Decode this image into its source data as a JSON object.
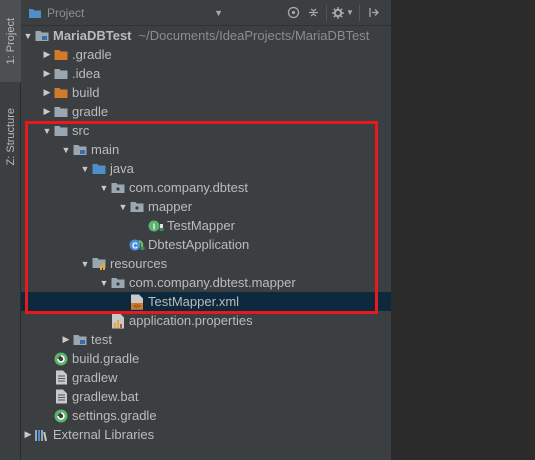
{
  "side_tabs": [
    {
      "label": "1: Project",
      "active": true
    },
    {
      "label": "Z: Structure",
      "active": false
    }
  ],
  "toolbar": {
    "view_label": "Project",
    "buttons": [
      "target-icon",
      "collapse-icon",
      "gear-icon",
      "hide-icon"
    ]
  },
  "tree": [
    {
      "label": "MariaDBTest",
      "path": "~/Documents/IdeaProjects/MariaDBTest",
      "depth": 0,
      "expanded": true,
      "icon": "module-folder-icon",
      "bold": true
    },
    {
      "label": ".gradle",
      "depth": 1,
      "expanded": false,
      "icon": "excluded-folder-icon"
    },
    {
      "label": ".idea",
      "depth": 1,
      "expanded": false,
      "icon": "folder-icon"
    },
    {
      "label": "build",
      "depth": 1,
      "expanded": false,
      "icon": "excluded-folder-icon"
    },
    {
      "label": "gradle",
      "depth": 1,
      "expanded": false,
      "icon": "folder-icon"
    },
    {
      "label": "src",
      "depth": 1,
      "expanded": true,
      "icon": "folder-icon"
    },
    {
      "label": "main",
      "depth": 2,
      "expanded": true,
      "icon": "module-folder-icon"
    },
    {
      "label": "java",
      "depth": 3,
      "expanded": true,
      "icon": "source-root-icon"
    },
    {
      "label": "com.company.dbtest",
      "depth": 4,
      "expanded": true,
      "icon": "package-icon"
    },
    {
      "label": "mapper",
      "depth": 5,
      "expanded": true,
      "icon": "package-icon"
    },
    {
      "label": "TestMapper",
      "depth": 6,
      "expanded": null,
      "icon": "interface-icon"
    },
    {
      "label": "DbtestApplication",
      "depth": 5,
      "expanded": null,
      "icon": "spring-class-icon"
    },
    {
      "label": "resources",
      "depth": 3,
      "expanded": true,
      "icon": "resources-root-icon"
    },
    {
      "label": "com.company.dbtest.mapper",
      "depth": 4,
      "expanded": true,
      "icon": "package-icon"
    },
    {
      "label": "TestMapper.xml",
      "depth": 5,
      "expanded": null,
      "icon": "xml-file-icon",
      "selected": true
    },
    {
      "label": "application.properties",
      "depth": 4,
      "expanded": null,
      "icon": "properties-file-icon"
    },
    {
      "label": "test",
      "depth": 2,
      "expanded": false,
      "icon": "module-folder-icon"
    },
    {
      "label": "build.gradle",
      "depth": 1,
      "expanded": null,
      "icon": "gradle-file-icon"
    },
    {
      "label": "gradlew",
      "depth": 1,
      "expanded": null,
      "icon": "text-file-icon"
    },
    {
      "label": "gradlew.bat",
      "depth": 1,
      "expanded": null,
      "icon": "text-file-icon"
    },
    {
      "label": "settings.gradle",
      "depth": 1,
      "expanded": null,
      "icon": "gradle-file-icon"
    },
    {
      "label": "External Libraries",
      "depth": 0,
      "expanded": false,
      "icon": "library-icon"
    }
  ],
  "colors": {
    "highlight_box": "#e8191c",
    "selection": "#0d293e",
    "excluded_folder": "#d07a2a",
    "folder": "#9aa7b0",
    "source_root": "#4f8fc8"
  }
}
